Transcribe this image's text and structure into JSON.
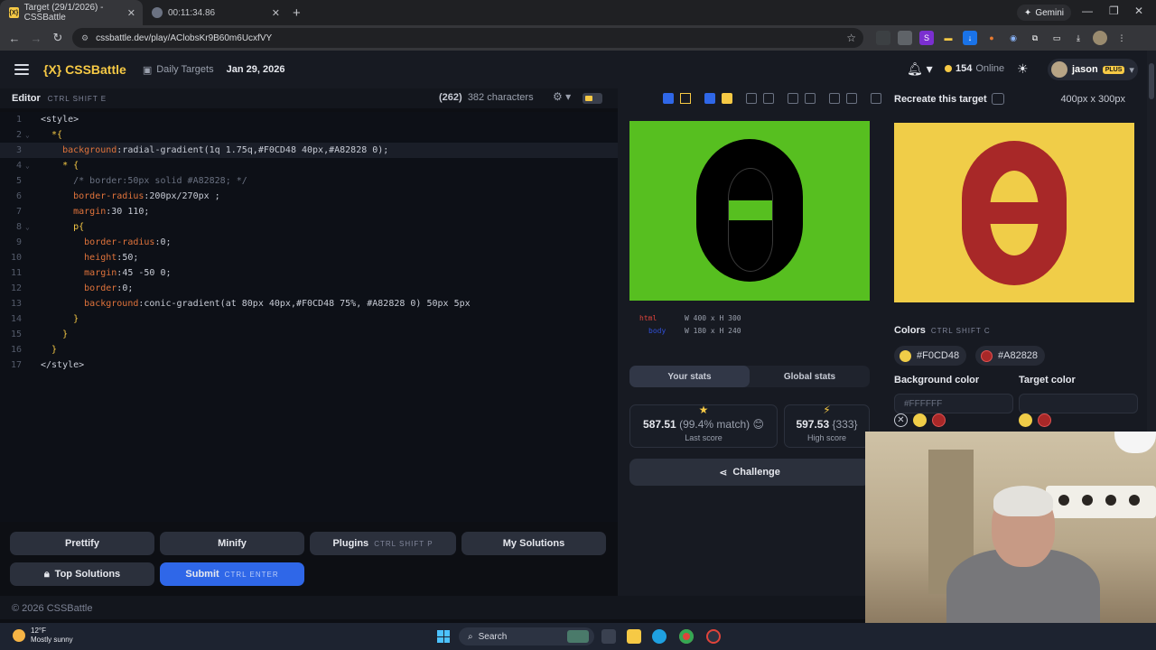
{
  "browser": {
    "tabs": [
      {
        "title": "Target (29/1/2026) - CSSBattle",
        "favicon": "css-battle"
      },
      {
        "title": "00:11:34.86",
        "favicon": "globe"
      }
    ],
    "url": "cssbattle.dev/play/AClobsKr9B60m6UcxfVY",
    "gemini_label": "Gemini"
  },
  "site": {
    "logo": "{X} CSSBattle",
    "breadcrumb": "Daily Targets",
    "date": "Jan 29, 2026",
    "online_count": "154",
    "online_label": "Online",
    "user": "jason",
    "plan_badge": "PLUS"
  },
  "editor": {
    "title": "Editor",
    "shortcut": "CTRL SHIFT E",
    "char_delta": "(262)",
    "char_count": "382 characters",
    "lines": [
      {
        "n": "1",
        "tokens": [
          [
            "t-tag",
            "<style>"
          ]
        ]
      },
      {
        "n": "2",
        "tokens": [
          [
            "t-sel",
            "  *{"
          ]
        ]
      },
      {
        "n": "3",
        "tokens": [
          [
            "t-prop",
            "    background"
          ],
          [
            "t-val",
            ":radial-gradient(1q 1.75q,#F0CD48 40px,#A82828 0);"
          ]
        ]
      },
      {
        "n": "4",
        "tokens": [
          [
            "t-sel",
            "    * {"
          ]
        ]
      },
      {
        "n": "5",
        "tokens": [
          [
            "t-com",
            "      /* border:50px solid #A82828; */"
          ]
        ]
      },
      {
        "n": "6",
        "tokens": [
          [
            "t-prop",
            "      border-radius"
          ],
          [
            "t-val",
            ":200px/270px ;"
          ]
        ]
      },
      {
        "n": "7",
        "tokens": [
          [
            "t-prop",
            "      margin"
          ],
          [
            "t-val",
            ":30 110;"
          ]
        ]
      },
      {
        "n": "8",
        "tokens": [
          [
            "t-sel",
            "      p{"
          ]
        ]
      },
      {
        "n": "9",
        "tokens": [
          [
            "t-prop",
            "        border-radius"
          ],
          [
            "t-val",
            ":0;"
          ]
        ]
      },
      {
        "n": "10",
        "tokens": [
          [
            "t-prop",
            "        height"
          ],
          [
            "t-val",
            ":50;"
          ]
        ]
      },
      {
        "n": "11",
        "tokens": [
          [
            "t-prop",
            "        margin"
          ],
          [
            "t-val",
            ":45 -50 0;"
          ]
        ]
      },
      {
        "n": "12",
        "tokens": [
          [
            "t-prop",
            "        border"
          ],
          [
            "t-val",
            ":0;"
          ]
        ]
      },
      {
        "n": "13",
        "tokens": [
          [
            "t-prop",
            "        background"
          ],
          [
            "t-val",
            ":conic-gradient(at 80px 40px,#F0CD48 75%, #A82828 0) 50px 5px"
          ]
        ]
      },
      {
        "n": "14",
        "tokens": [
          [
            "t-sel",
            "      }"
          ]
        ]
      },
      {
        "n": "15",
        "tokens": [
          [
            "t-sel",
            "    }"
          ]
        ]
      },
      {
        "n": "16",
        "tokens": [
          [
            "t-sel",
            "  }"
          ]
        ]
      },
      {
        "n": "17",
        "tokens": [
          [
            "t-tag",
            "</style>"
          ]
        ]
      }
    ]
  },
  "buttons": {
    "prettify": "Prettify",
    "minify": "Minify",
    "plugins": "Plugins",
    "plugins_key": "CTRL SHIFT P",
    "my_solutions": "My Solutions",
    "top_solutions": "Top Solutions",
    "submit": "Submit",
    "submit_key": "CTRL ENTER"
  },
  "output": {
    "dim_html": "html",
    "dim_html_size": "W 400 x H 300",
    "dim_body": "body",
    "dim_body_size": "W 180 x H 240",
    "tab_your": "Your stats",
    "tab_global": "Global stats",
    "last_score": "587.51",
    "last_match": "(99.4% match)",
    "last_label": "Last score",
    "high_score": "597.53",
    "high_chars": "{333}",
    "high_label": "High score",
    "challenge": "Challenge"
  },
  "target": {
    "title": "Recreate this target",
    "size": "400px x 300px",
    "colors_title": "Colors",
    "colors_key": "CTRL SHIFT C",
    "colors": [
      "#F0CD48",
      "#A82828"
    ],
    "bg_label": "Background color",
    "target_label": "Target color",
    "bg_placeholder": "#FFFFFF"
  },
  "footer": {
    "copyright": "© 2026 CSSBattle"
  },
  "taskbar": {
    "temp": "12°F",
    "weather": "Mostly sunny",
    "search": "Search"
  }
}
